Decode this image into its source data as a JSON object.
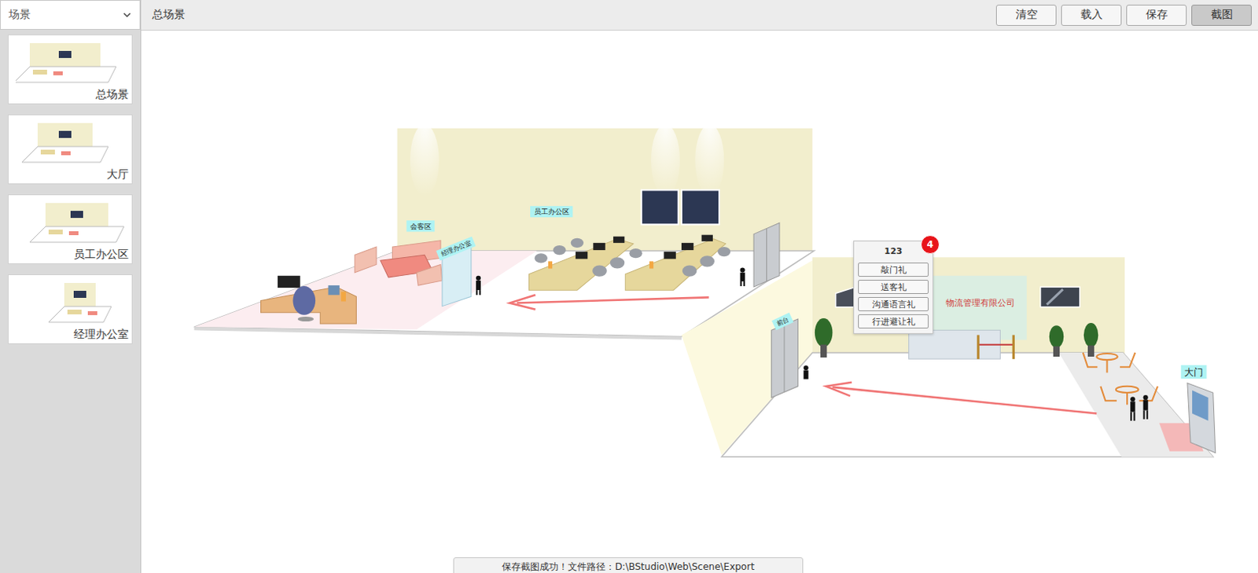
{
  "sidebar": {
    "dropdown": {
      "label": "场景"
    },
    "items": [
      {
        "label": "总场景"
      },
      {
        "label": "大厅"
      },
      {
        "label": "员工办公区"
      },
      {
        "label": "经理办公室"
      }
    ]
  },
  "toolbar": {
    "title": "总场景",
    "buttons": [
      {
        "label": "清空",
        "selected": false
      },
      {
        "label": "载入",
        "selected": false
      },
      {
        "label": "保存",
        "selected": false
      },
      {
        "label": "截图",
        "selected": true
      }
    ]
  },
  "scene": {
    "labels": {
      "meeting": "会客区",
      "staff": "员工办公区",
      "manager": "经理办公室",
      "reception": "前台",
      "gate": "大门"
    },
    "company": "物流管理有限公司"
  },
  "popup": {
    "title": "123",
    "badge": "4",
    "actions": [
      "敲门礼",
      "送客礼",
      "沟通语言礼",
      "行进避让礼"
    ]
  },
  "toast": "保存截图成功！文件路径：D:\\BStudio\\Web\\Scene\\Export"
}
